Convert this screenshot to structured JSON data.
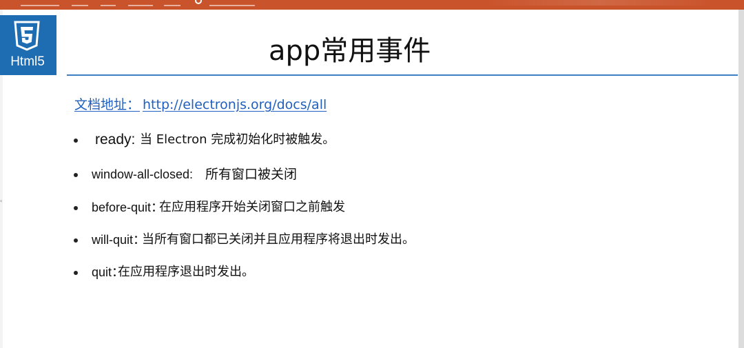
{
  "logo": {
    "label": "Html5",
    "brand_color": "#1e6db2"
  },
  "slide": {
    "title": "app常用事件",
    "doc_link": {
      "label": "文档地址：",
      "url": "http://electronjs.org/docs/all",
      "color": "#1f5fbf"
    },
    "bullets": [
      {
        "term": "ready:",
        "desc": "当 Electron 完成初始化时被触发。"
      },
      {
        "term": "window-all-closed:",
        "desc": "所有窗口被关闭"
      },
      {
        "term": "before-quit：",
        "desc": "在应用程序开始关闭窗口之前触发"
      },
      {
        "term": "will-quit：",
        "desc": "当所有窗口都已关闭并且应用程序将退出时发出。"
      },
      {
        "term": "quit：",
        "desc": "在应用程序退出时发出。"
      }
    ]
  },
  "colors": {
    "ribbon": "#c9532b",
    "title_rule": "#3e7fc4"
  },
  "icons": {
    "ribbon_hint": "lightbulb-icon",
    "logo": "html5-shield-icon"
  }
}
